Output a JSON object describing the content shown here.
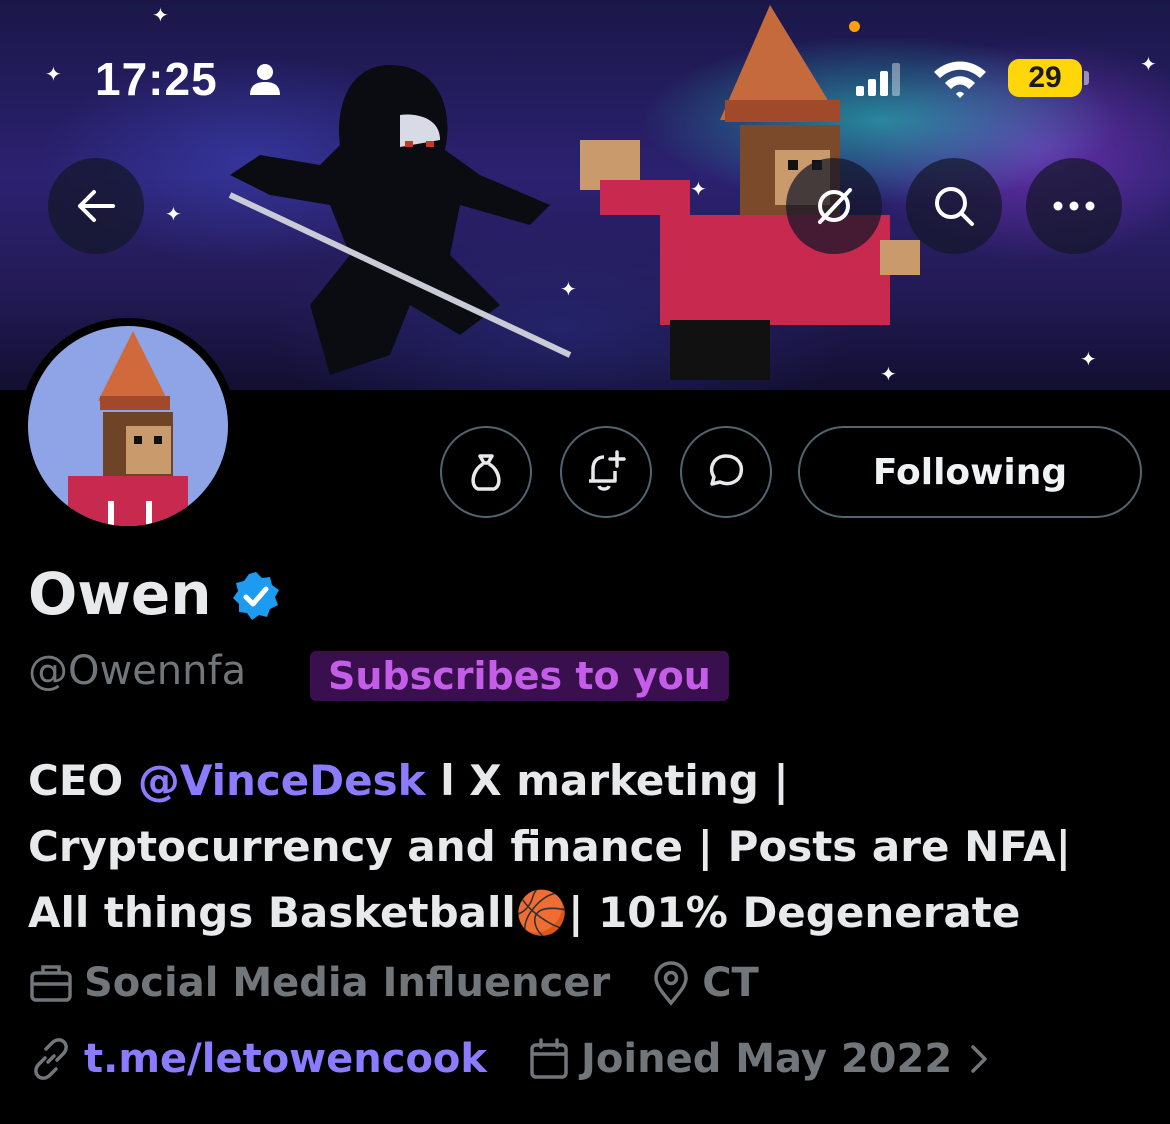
{
  "status_bar": {
    "time": "17:25",
    "battery": "29"
  },
  "nav": {
    "back_icon": "arrow-left-icon",
    "grok_icon": "grok-icon",
    "search_icon": "search-icon",
    "more_icon": "more-horizontal-icon"
  },
  "profile_actions": {
    "tip_icon": "money-bag-icon",
    "notify_icon": "bell-plus-icon",
    "message_icon": "chat-bubble-icon",
    "following_label": "Following"
  },
  "profile": {
    "name": "Owen",
    "handle": "@Owennfa",
    "subscribes_badge": "Subscribes to you",
    "bio": {
      "prefix": "CEO ",
      "mention": "@VinceDesk",
      "text": " l X marketing | Cryptocurrency and finance | Posts are NFA| All things Basketball",
      "emoji": "🏀",
      "suffix": "| 101% Degenerate"
    },
    "profession": "Social Media Influencer",
    "location": "CT",
    "website": "t.me/letowencook",
    "joined": "Joined May 2022"
  },
  "colors": {
    "background": "#000000",
    "text": "#e7e9ea",
    "muted": "#71767b",
    "link": "#8a7bff",
    "verified": "#1d9bf0",
    "badge_bg": "#3a0f4d",
    "badge_text": "#c45ee8",
    "battery": "#ffd60a"
  }
}
